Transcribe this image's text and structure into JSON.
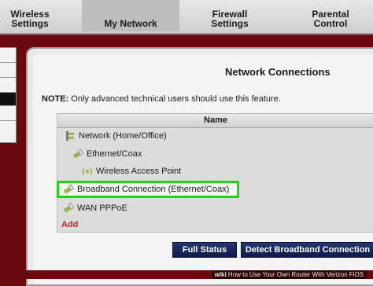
{
  "nav": {
    "tabs": [
      {
        "label": "Wireless\nSettings"
      },
      {
        "label": "My Network"
      },
      {
        "label": "Firewall\nSettings"
      },
      {
        "label": "Parental\nControl"
      }
    ]
  },
  "page": {
    "title": "Network Connections",
    "note_bold": "NOTE:",
    "note_text": " Only advanced technical users should use this feature."
  },
  "table": {
    "header": "Name",
    "rows": [
      {
        "label": "Network (Home/Office)",
        "icon": "network-icon"
      },
      {
        "label": "Ethernet/Coax",
        "icon": "ethernet-icon"
      },
      {
        "label": "Wireless Access Point",
        "icon": "wireless-icon"
      },
      {
        "label": "Broadband Connection (Ethernet/Coax)",
        "icon": "broadband-icon"
      },
      {
        "label": "WAN PPPoE",
        "icon": "wan-icon"
      }
    ],
    "add_label": "Add"
  },
  "buttons": {
    "full_status": "Full Status",
    "detect": "Detect Broadband Connection"
  },
  "watermark": {
    "brand": "wiki",
    "text": "How to Use Your Own Router With Verizon FiOS"
  },
  "colors": {
    "highlight": "#22d40f",
    "background": "#6b0a0e",
    "button": "#1b2760",
    "add_link": "#c8202a"
  }
}
